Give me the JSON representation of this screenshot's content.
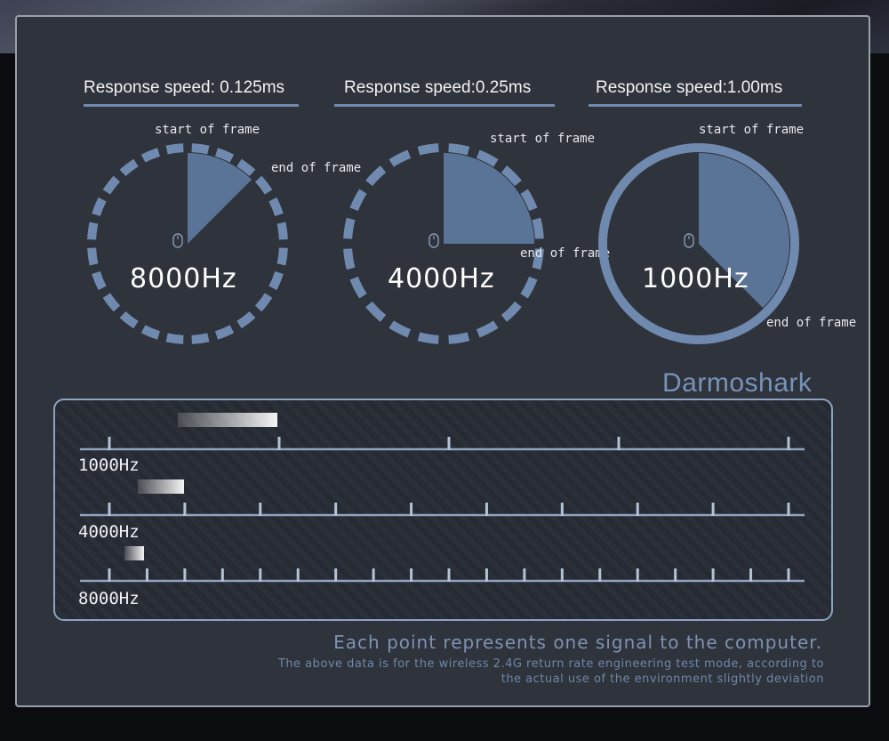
{
  "speeds": [
    {
      "label": "Response speed: 0.125ms",
      "frequency": "8000Hz",
      "start_label": "start of frame",
      "end_label": "end of frame",
      "sweep_degrees": 45
    },
    {
      "label": "Response speed:0.25ms",
      "frequency": "4000Hz",
      "start_label": "start of frame",
      "end_label": "end of frame",
      "sweep_degrees": 90
    },
    {
      "label": "Response speed:1.00ms",
      "frequency": "1000Hz",
      "start_label": "start of frame",
      "end_label": "end of frame",
      "sweep_degrees": 135
    }
  ],
  "brand": "Darmoshark",
  "timelines": [
    {
      "label": "1000Hz",
      "ticks": 5
    },
    {
      "label": "4000Hz",
      "ticks": 10
    },
    {
      "label": "8000Hz",
      "ticks": 19
    }
  ],
  "footer": {
    "main": "Each point represents one signal to the computer.",
    "note_line1": "The above data is for the wireless 2.4G return rate engineering test mode, according to",
    "note_line2": "the actual use of the environment slightly deviation"
  },
  "colors": {
    "accent": "#6f8aae",
    "sector": "#5d7aa0",
    "panel": "#2f333c"
  },
  "icons": {
    "mouse": "mouse-icon"
  }
}
